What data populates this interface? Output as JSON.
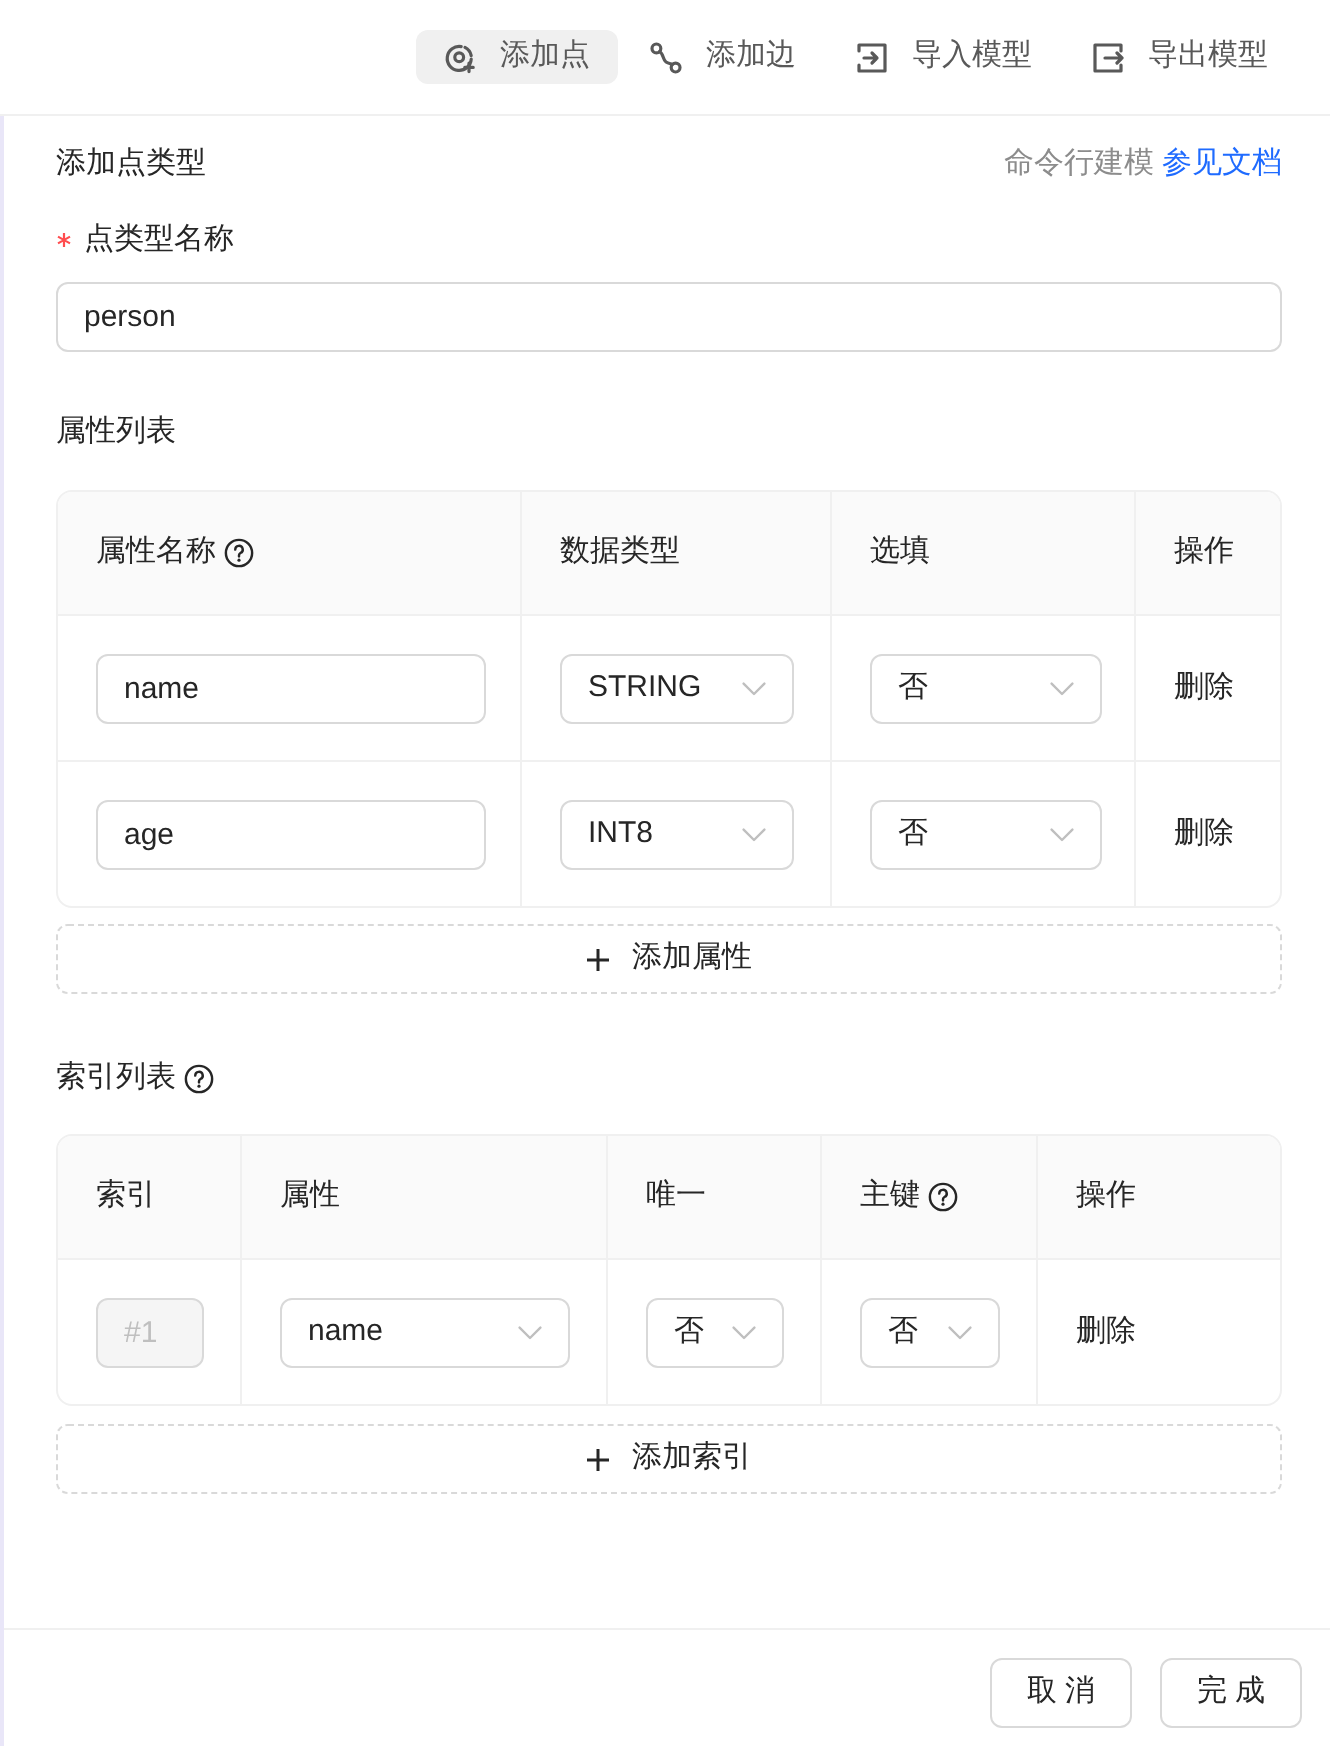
{
  "toolbar": {
    "items": [
      {
        "kind": "node",
        "label": "添加点",
        "selected": true
      },
      {
        "kind": "edge",
        "label": "添加边",
        "selected": false
      },
      {
        "kind": "import",
        "label": "导入模型",
        "selected": false
      },
      {
        "kind": "export",
        "label": "导出模型",
        "selected": false
      }
    ]
  },
  "panel": {
    "title": "添加点类型",
    "cli_hint": "命令行建模",
    "doc_link": "参见文档"
  },
  "name_field": {
    "label": "点类型名称",
    "required": true,
    "value": "person"
  },
  "property_list": {
    "title": "属性列表",
    "columns": [
      {
        "label": "属性名称",
        "help": true
      },
      {
        "label": "数据类型",
        "help": false
      },
      {
        "label": "选填",
        "help": false
      },
      {
        "label": "操作",
        "help": false
      }
    ],
    "rows": [
      {
        "name": "name",
        "data_type": "STRING",
        "optional": "否",
        "action": "删除"
      },
      {
        "name": "age",
        "data_type": "INT8",
        "optional": "否",
        "action": "删除"
      }
    ],
    "add_button": "添加属性"
  },
  "index_list": {
    "title": "索引列表",
    "help": true,
    "columns": [
      {
        "label": "索引",
        "help": false
      },
      {
        "label": "属性",
        "help": false
      },
      {
        "label": "唯一",
        "help": false
      },
      {
        "label": "主键",
        "help": true
      },
      {
        "label": "操作",
        "help": false
      }
    ],
    "rows": [
      {
        "index": "#1",
        "index_disabled": true,
        "property": "name",
        "unique": "否",
        "primary_key": "否",
        "action": "删除"
      }
    ],
    "add_button": "添加索引"
  },
  "footer": {
    "buttons": [
      {
        "label": "取消"
      },
      {
        "label": "完成"
      }
    ]
  }
}
